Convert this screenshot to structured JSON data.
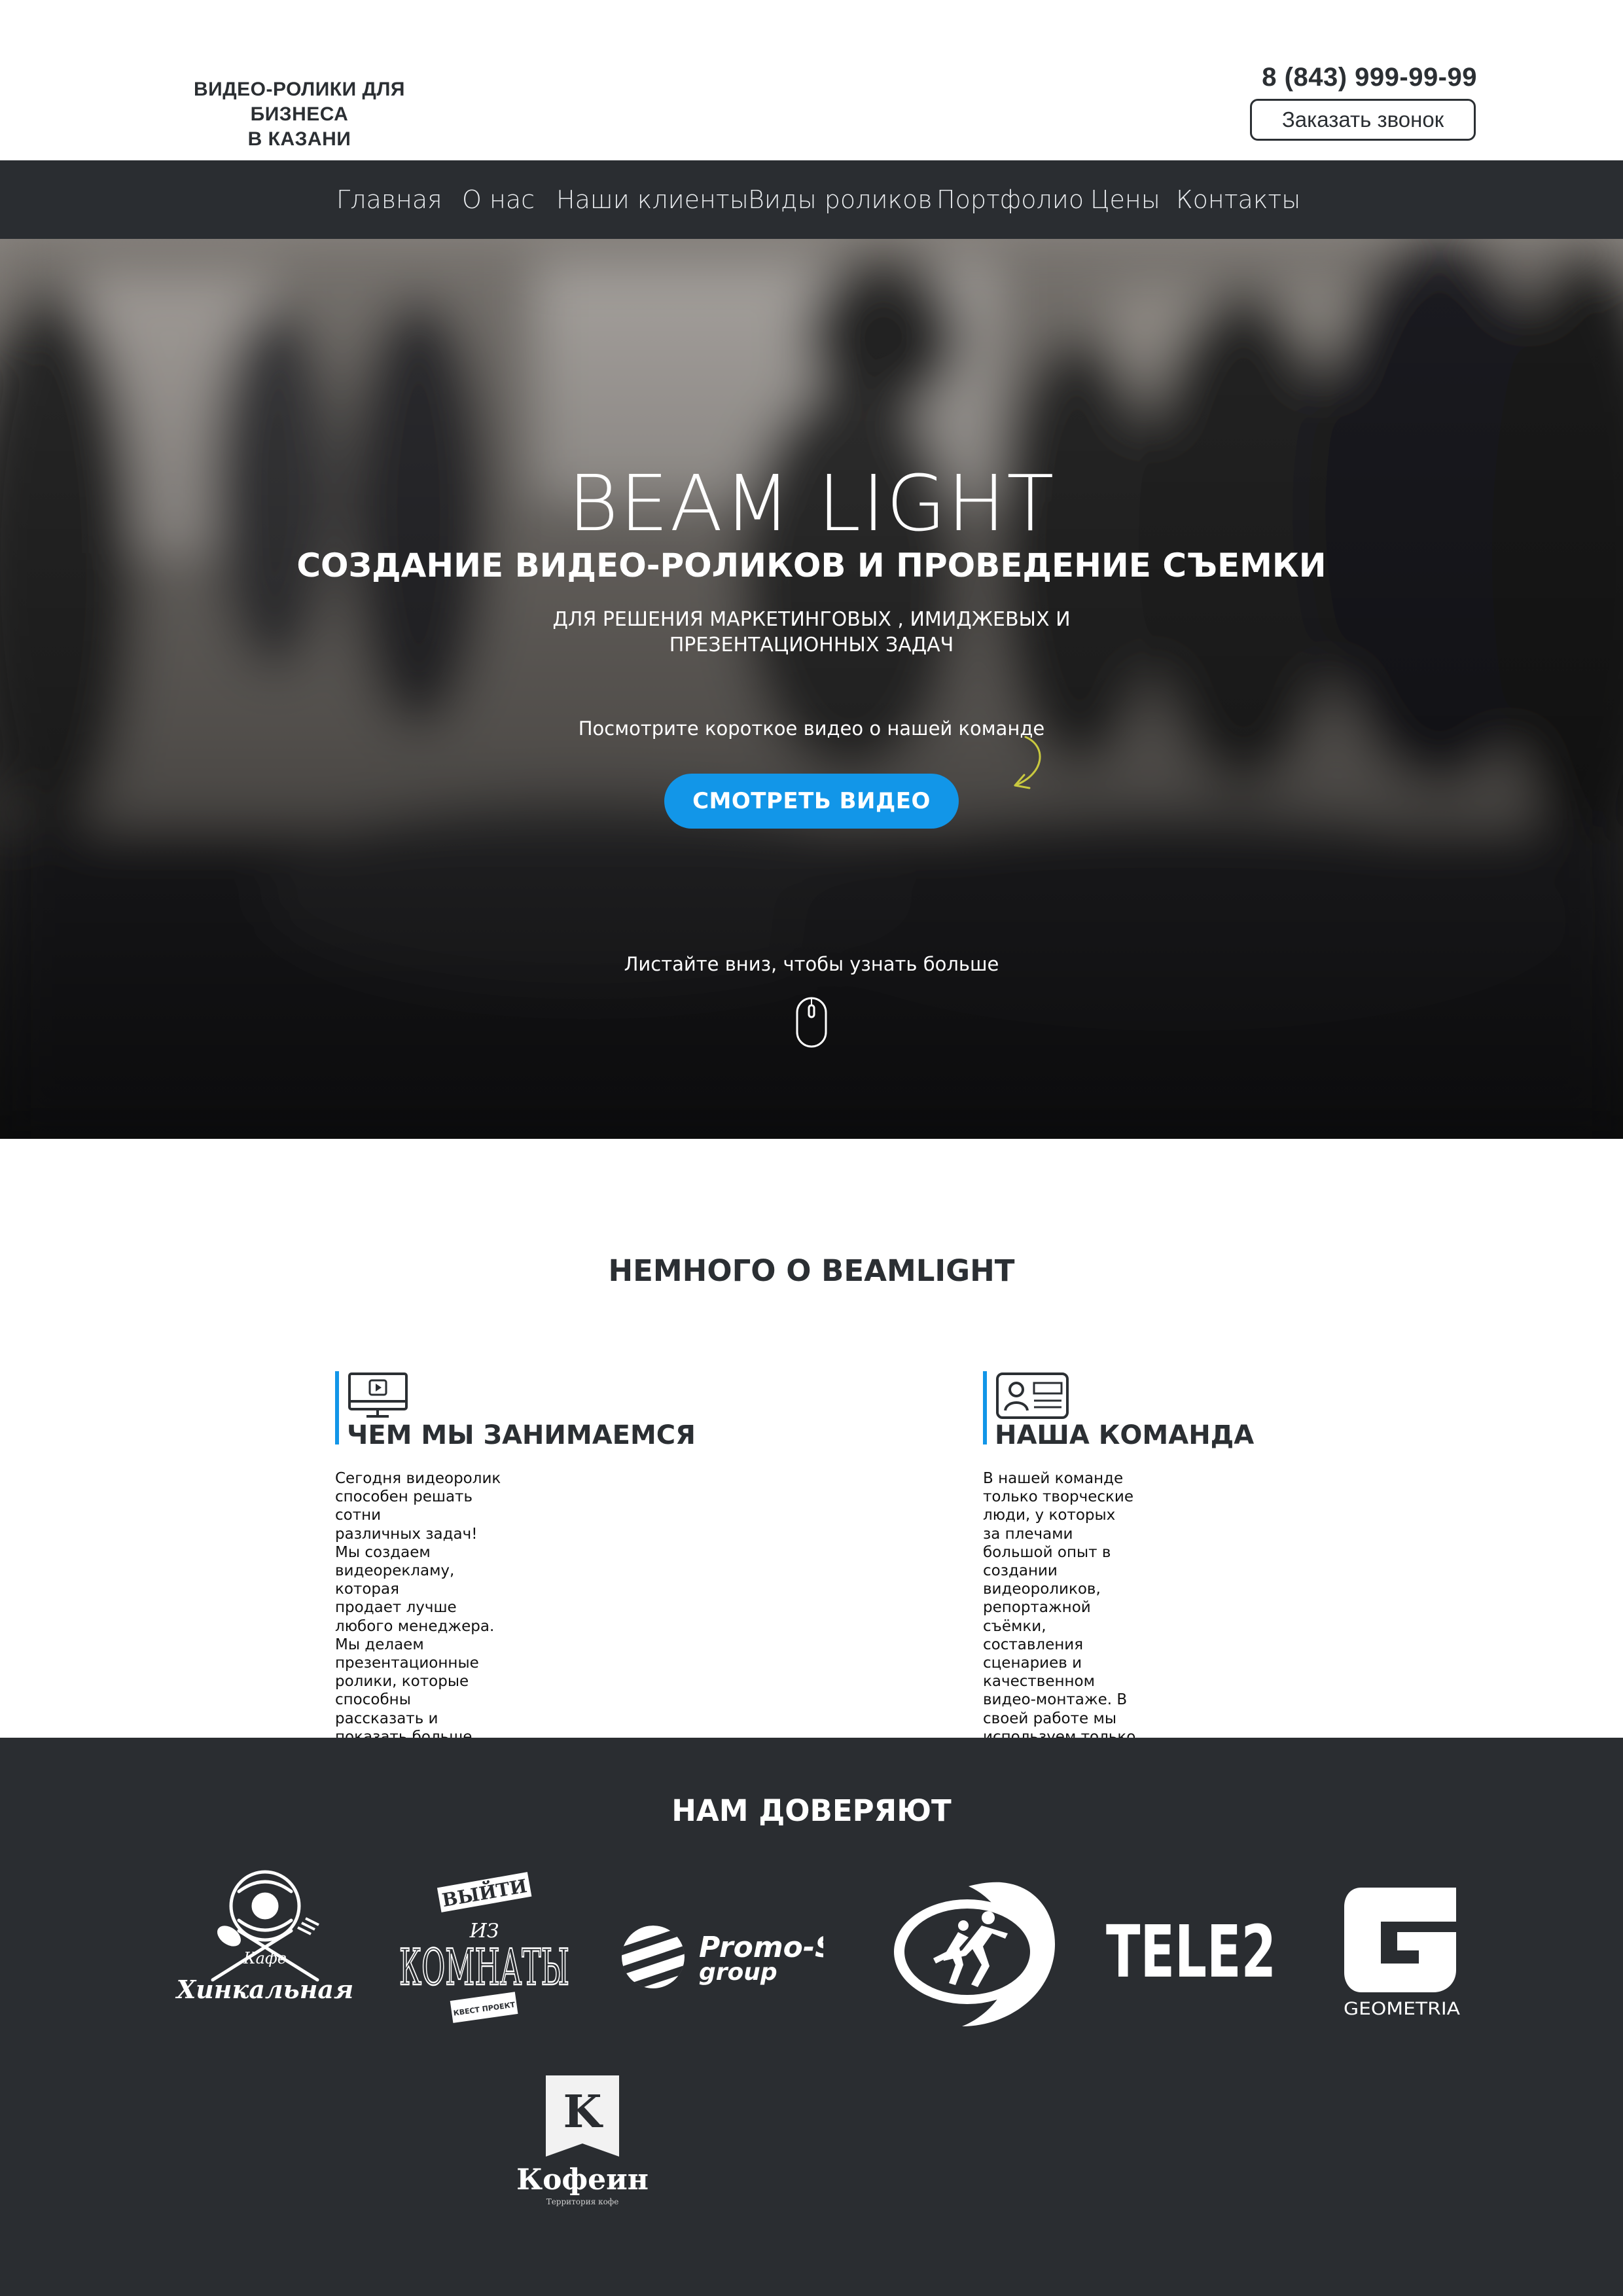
{
  "header": {
    "brand_line1": "ВИДЕО-РОЛИКИ ДЛЯ БИЗНЕСА",
    "brand_line2": "В КАЗАНИ",
    "phone": "8 (843) 999-99-99",
    "callback_label": "Заказать звонок"
  },
  "nav": {
    "items": [
      {
        "label": "Главная"
      },
      {
        "label": "О нас"
      },
      {
        "label": "Наши клиенты"
      },
      {
        "label": "Виды роликов"
      },
      {
        "label": "Портфолио"
      },
      {
        "label": "Цены"
      },
      {
        "label": "Контакты"
      }
    ]
  },
  "hero": {
    "title": "BEAM LIGHT",
    "subtitle": "СОЗДАНИЕ ВИДЕО-РОЛИКОВ И ПРОВЕДЕНИЕ СЪЕМКИ",
    "description_line1": "ДЛЯ РЕШЕНИЯ МАРКЕТИНГОВЫХ , ИМИДЖЕВЫХ И",
    "description_line2": "ПРЕЗЕНТАЦИОННЫХ ЗАДАЧ",
    "watch_hint": "Посмотрите короткое видео о нашей команде",
    "cta_label": "СМОТРЕТЬ ВИДЕО",
    "scroll_hint": "Листайте вниз, чтобы узнать больше",
    "icons": {
      "arrow": "curved-arrow-icon",
      "scroll": "mouse-icon"
    },
    "accent_color": "#1296e8"
  },
  "about": {
    "title": "НЕМНОГО О BEAMLIGHT",
    "columns": [
      {
        "icon": "monitor-play-icon",
        "heading": "ЧЕМ МЫ ЗАНИМАЕМСЯ",
        "text": "Сегодня видеоролик способен решать сотни\nразличных задач! Мы создаем видеорекламу, которая\nпродает лучше любого менеджера. Мы делаем\nпрезентационные ролики, которые способны\nрассказать и показать больше, чем любая\nмногочасовая лайв-презентация. А наши\nкорпоративные и имиджевые видео позволяют\nэффективно продемонстрировать лучшие стороны\nлюбого продукта, бизнеса или организации."
      },
      {
        "icon": "id-card-icon",
        "heading": "НАША КОМАНДА",
        "text": "В нашей команде только творческие люди, у которых\nза плечами большой опыт в создании видеороликов,\nрепортажной съёмки, составления сценариев и\nкачественном видео-монтаже. В своей работе мы\nиспользуем только современную и\nпрофессиональную технику\nВместе мы - команда профессионалов своего дела."
      }
    ]
  },
  "trust": {
    "title": "НАМ ДОВЕРЯЮТ",
    "logos": [
      {
        "name": "khinkalnaya-logo",
        "text_small": "Кафе",
        "text": "Хинкальная"
      },
      {
        "name": "vyiti-iz-komnaty-logo",
        "text_top": "ВЫЙТИ",
        "text_mid": "ИЗ",
        "text": "КОМНАТЫ",
        "text_sub": "КВЕСТ ПРОЕКТ"
      },
      {
        "name": "promo-s-group-logo",
        "text": "Promo-S",
        "text_sub": "group"
      },
      {
        "name": "runners-oval-logo"
      },
      {
        "name": "tele2-logo",
        "text": "TELE2"
      },
      {
        "name": "geometria-logo",
        "text": "GEOMETRIA"
      },
      {
        "name": "kofein-logo",
        "letter": "K",
        "text": "Кофеин",
        "text_sub": "Территория кофе"
      }
    ]
  }
}
